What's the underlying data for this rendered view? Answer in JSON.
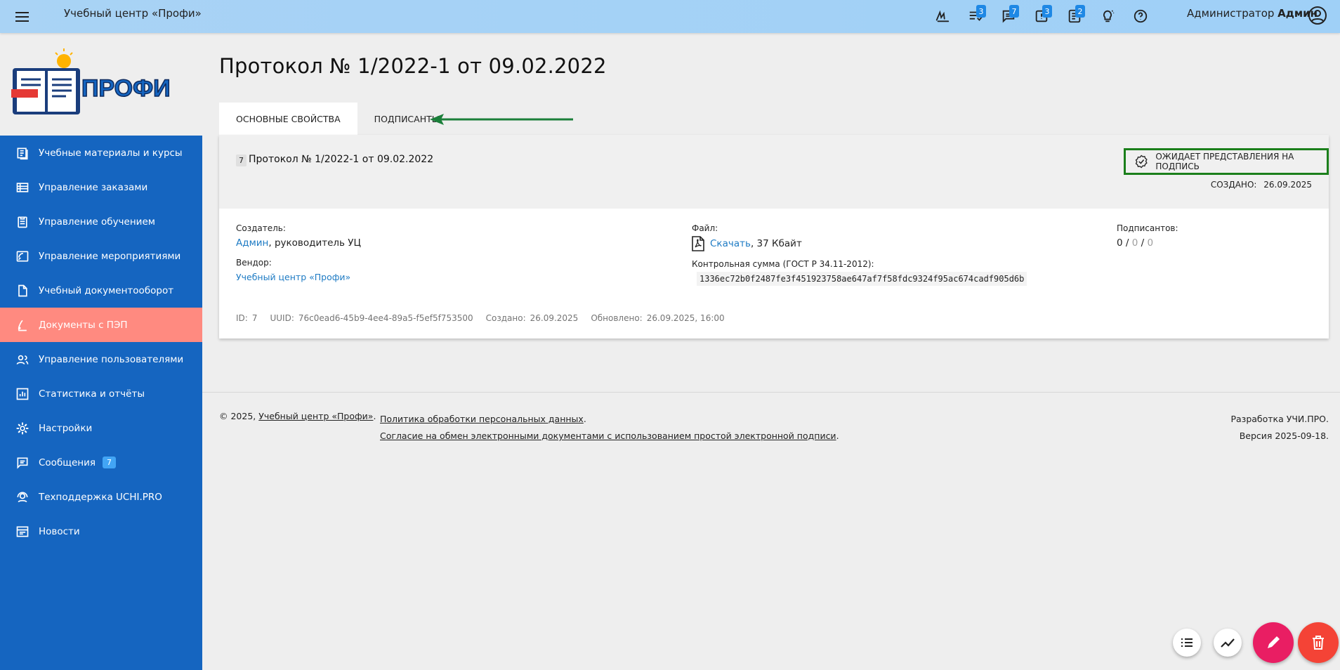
{
  "header": {
    "app_title": "Учебный центр «Профи»",
    "user_role": "Администратор",
    "user_name": "Админ",
    "icons": [
      {
        "name": "signature-icon",
        "badge": ""
      },
      {
        "name": "tasks-icon",
        "badge": "3"
      },
      {
        "name": "chat-icon",
        "badge": "7"
      },
      {
        "name": "notice-icon",
        "badge": "3"
      },
      {
        "name": "list-icon",
        "badge": "2"
      },
      {
        "name": "bulb-icon",
        "badge": ""
      },
      {
        "name": "help-icon",
        "badge": ""
      }
    ]
  },
  "logo": {
    "text": "ПРОФИ"
  },
  "sidebar": {
    "items": [
      {
        "label": "Учебные материалы и курсы",
        "icon": "library-icon"
      },
      {
        "label": "Управление заказами",
        "icon": "table-icon"
      },
      {
        "label": "Управление обучением",
        "icon": "clipboard-icon"
      },
      {
        "label": "Управление мероприятиями",
        "icon": "broadcast-icon"
      },
      {
        "label": "Учебный документооборот",
        "icon": "document-icon"
      },
      {
        "label": "Документы с ПЭП",
        "icon": "pen-icon",
        "active": true
      },
      {
        "label": "Управление пользователями",
        "icon": "users-icon"
      },
      {
        "label": "Статистика и отчёты",
        "icon": "chart-icon"
      },
      {
        "label": "Настройки",
        "icon": "gear-icon"
      },
      {
        "label": "Сообщения",
        "icon": "message-icon",
        "badge": "7"
      },
      {
        "label": "Техподдержка UCHI.PRO",
        "icon": "support-icon"
      },
      {
        "label": "Новости",
        "icon": "news-icon"
      }
    ]
  },
  "page": {
    "title": "Протокол № 1/2022-1 от 09.02.2022",
    "tabs": [
      {
        "label": "Основные свойства",
        "active": true
      },
      {
        "label": "Подписанты",
        "active": false
      }
    ]
  },
  "card": {
    "id_chip": "7",
    "doc_name": "Протокол № 1/2022-1 от 09.02.2022",
    "status": "Ожидает представления на подпись",
    "created_label": "Создано:",
    "created_value": "26.09.2025",
    "creator_label": "Создатель:",
    "creator_link": "Админ",
    "creator_rest": ", руководитель УЦ",
    "vendor_label": "Вендор:",
    "vendor_link": "Учебный центр «Профи»",
    "file_label": "Файл:",
    "file_link": "Скачать",
    "file_size": ", 37 Кбайт",
    "checksum_label": "Контрольная сумма (ГОСТ Р 34.11-2012):",
    "checksum": "1336ec72b0f2487fe3f451923758ae647af7f58fdc9324f95ac674cadf905d6b",
    "signers_label": "Подписантов:",
    "signers_a": "0",
    "signers_b": "0",
    "signers_c": "0",
    "meta": {
      "id_label": "ID:",
      "id_value": "7",
      "uuid_label": "UUID:",
      "uuid_value": "76c0ead6-45b9-4ee4-89a5-f5ef5f753500",
      "created_label": "Создано:",
      "created_value": "26.09.2025",
      "updated_label": "Обновлено:",
      "updated_value": "26.09.2025, 16:00"
    }
  },
  "footer": {
    "copyright": "© 2025,",
    "org_link": "Учебный центр «Профи»",
    "policy_link": "Политика обработки персональных данных",
    "consent_link": "Согласие на обмен электронными документами с использованием простой электронной подписи",
    "dev": "Разработка УЧИ.ПРО.",
    "version": "Версия 2025-09-18."
  },
  "colors": {
    "topbar": "#a9d3f5",
    "sidebar": "#1565c0",
    "active_item": "#ff8a80",
    "status_border": "#1b7f1b",
    "fab_edit": "#e91e63",
    "fab_delete": "#f44336"
  }
}
